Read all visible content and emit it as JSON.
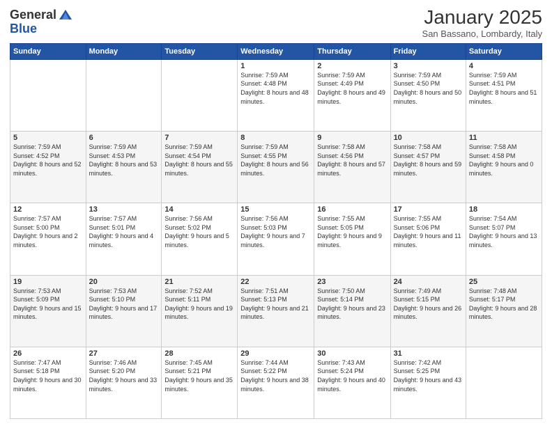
{
  "logo": {
    "general": "General",
    "blue": "Blue"
  },
  "title": "January 2025",
  "location": "San Bassano, Lombardy, Italy",
  "headers": [
    "Sunday",
    "Monday",
    "Tuesday",
    "Wednesday",
    "Thursday",
    "Friday",
    "Saturday"
  ],
  "rows": [
    [
      {
        "day": "",
        "sunrise": "",
        "sunset": "",
        "daylight": ""
      },
      {
        "day": "",
        "sunrise": "",
        "sunset": "",
        "daylight": ""
      },
      {
        "day": "",
        "sunrise": "",
        "sunset": "",
        "daylight": ""
      },
      {
        "day": "1",
        "sunrise": "Sunrise: 7:59 AM",
        "sunset": "Sunset: 4:48 PM",
        "daylight": "Daylight: 8 hours and 48 minutes."
      },
      {
        "day": "2",
        "sunrise": "Sunrise: 7:59 AM",
        "sunset": "Sunset: 4:49 PM",
        "daylight": "Daylight: 8 hours and 49 minutes."
      },
      {
        "day": "3",
        "sunrise": "Sunrise: 7:59 AM",
        "sunset": "Sunset: 4:50 PM",
        "daylight": "Daylight: 8 hours and 50 minutes."
      },
      {
        "day": "4",
        "sunrise": "Sunrise: 7:59 AM",
        "sunset": "Sunset: 4:51 PM",
        "daylight": "Daylight: 8 hours and 51 minutes."
      }
    ],
    [
      {
        "day": "5",
        "sunrise": "Sunrise: 7:59 AM",
        "sunset": "Sunset: 4:52 PM",
        "daylight": "Daylight: 8 hours and 52 minutes."
      },
      {
        "day": "6",
        "sunrise": "Sunrise: 7:59 AM",
        "sunset": "Sunset: 4:53 PM",
        "daylight": "Daylight: 8 hours and 53 minutes."
      },
      {
        "day": "7",
        "sunrise": "Sunrise: 7:59 AM",
        "sunset": "Sunset: 4:54 PM",
        "daylight": "Daylight: 8 hours and 55 minutes."
      },
      {
        "day": "8",
        "sunrise": "Sunrise: 7:59 AM",
        "sunset": "Sunset: 4:55 PM",
        "daylight": "Daylight: 8 hours and 56 minutes."
      },
      {
        "day": "9",
        "sunrise": "Sunrise: 7:58 AM",
        "sunset": "Sunset: 4:56 PM",
        "daylight": "Daylight: 8 hours and 57 minutes."
      },
      {
        "day": "10",
        "sunrise": "Sunrise: 7:58 AM",
        "sunset": "Sunset: 4:57 PM",
        "daylight": "Daylight: 8 hours and 59 minutes."
      },
      {
        "day": "11",
        "sunrise": "Sunrise: 7:58 AM",
        "sunset": "Sunset: 4:58 PM",
        "daylight": "Daylight: 9 hours and 0 minutes."
      }
    ],
    [
      {
        "day": "12",
        "sunrise": "Sunrise: 7:57 AM",
        "sunset": "Sunset: 5:00 PM",
        "daylight": "Daylight: 9 hours and 2 minutes."
      },
      {
        "day": "13",
        "sunrise": "Sunrise: 7:57 AM",
        "sunset": "Sunset: 5:01 PM",
        "daylight": "Daylight: 9 hours and 4 minutes."
      },
      {
        "day": "14",
        "sunrise": "Sunrise: 7:56 AM",
        "sunset": "Sunset: 5:02 PM",
        "daylight": "Daylight: 9 hours and 5 minutes."
      },
      {
        "day": "15",
        "sunrise": "Sunrise: 7:56 AM",
        "sunset": "Sunset: 5:03 PM",
        "daylight": "Daylight: 9 hours and 7 minutes."
      },
      {
        "day": "16",
        "sunrise": "Sunrise: 7:55 AM",
        "sunset": "Sunset: 5:05 PM",
        "daylight": "Daylight: 9 hours and 9 minutes."
      },
      {
        "day": "17",
        "sunrise": "Sunrise: 7:55 AM",
        "sunset": "Sunset: 5:06 PM",
        "daylight": "Daylight: 9 hours and 11 minutes."
      },
      {
        "day": "18",
        "sunrise": "Sunrise: 7:54 AM",
        "sunset": "Sunset: 5:07 PM",
        "daylight": "Daylight: 9 hours and 13 minutes."
      }
    ],
    [
      {
        "day": "19",
        "sunrise": "Sunrise: 7:53 AM",
        "sunset": "Sunset: 5:09 PM",
        "daylight": "Daylight: 9 hours and 15 minutes."
      },
      {
        "day": "20",
        "sunrise": "Sunrise: 7:53 AM",
        "sunset": "Sunset: 5:10 PM",
        "daylight": "Daylight: 9 hours and 17 minutes."
      },
      {
        "day": "21",
        "sunrise": "Sunrise: 7:52 AM",
        "sunset": "Sunset: 5:11 PM",
        "daylight": "Daylight: 9 hours and 19 minutes."
      },
      {
        "day": "22",
        "sunrise": "Sunrise: 7:51 AM",
        "sunset": "Sunset: 5:13 PM",
        "daylight": "Daylight: 9 hours and 21 minutes."
      },
      {
        "day": "23",
        "sunrise": "Sunrise: 7:50 AM",
        "sunset": "Sunset: 5:14 PM",
        "daylight": "Daylight: 9 hours and 23 minutes."
      },
      {
        "day": "24",
        "sunrise": "Sunrise: 7:49 AM",
        "sunset": "Sunset: 5:15 PM",
        "daylight": "Daylight: 9 hours and 26 minutes."
      },
      {
        "day": "25",
        "sunrise": "Sunrise: 7:48 AM",
        "sunset": "Sunset: 5:17 PM",
        "daylight": "Daylight: 9 hours and 28 minutes."
      }
    ],
    [
      {
        "day": "26",
        "sunrise": "Sunrise: 7:47 AM",
        "sunset": "Sunset: 5:18 PM",
        "daylight": "Daylight: 9 hours and 30 minutes."
      },
      {
        "day": "27",
        "sunrise": "Sunrise: 7:46 AM",
        "sunset": "Sunset: 5:20 PM",
        "daylight": "Daylight: 9 hours and 33 minutes."
      },
      {
        "day": "28",
        "sunrise": "Sunrise: 7:45 AM",
        "sunset": "Sunset: 5:21 PM",
        "daylight": "Daylight: 9 hours and 35 minutes."
      },
      {
        "day": "29",
        "sunrise": "Sunrise: 7:44 AM",
        "sunset": "Sunset: 5:22 PM",
        "daylight": "Daylight: 9 hours and 38 minutes."
      },
      {
        "day": "30",
        "sunrise": "Sunrise: 7:43 AM",
        "sunset": "Sunset: 5:24 PM",
        "daylight": "Daylight: 9 hours and 40 minutes."
      },
      {
        "day": "31",
        "sunrise": "Sunrise: 7:42 AM",
        "sunset": "Sunset: 5:25 PM",
        "daylight": "Daylight: 9 hours and 43 minutes."
      },
      {
        "day": "",
        "sunrise": "",
        "sunset": "",
        "daylight": ""
      }
    ]
  ]
}
